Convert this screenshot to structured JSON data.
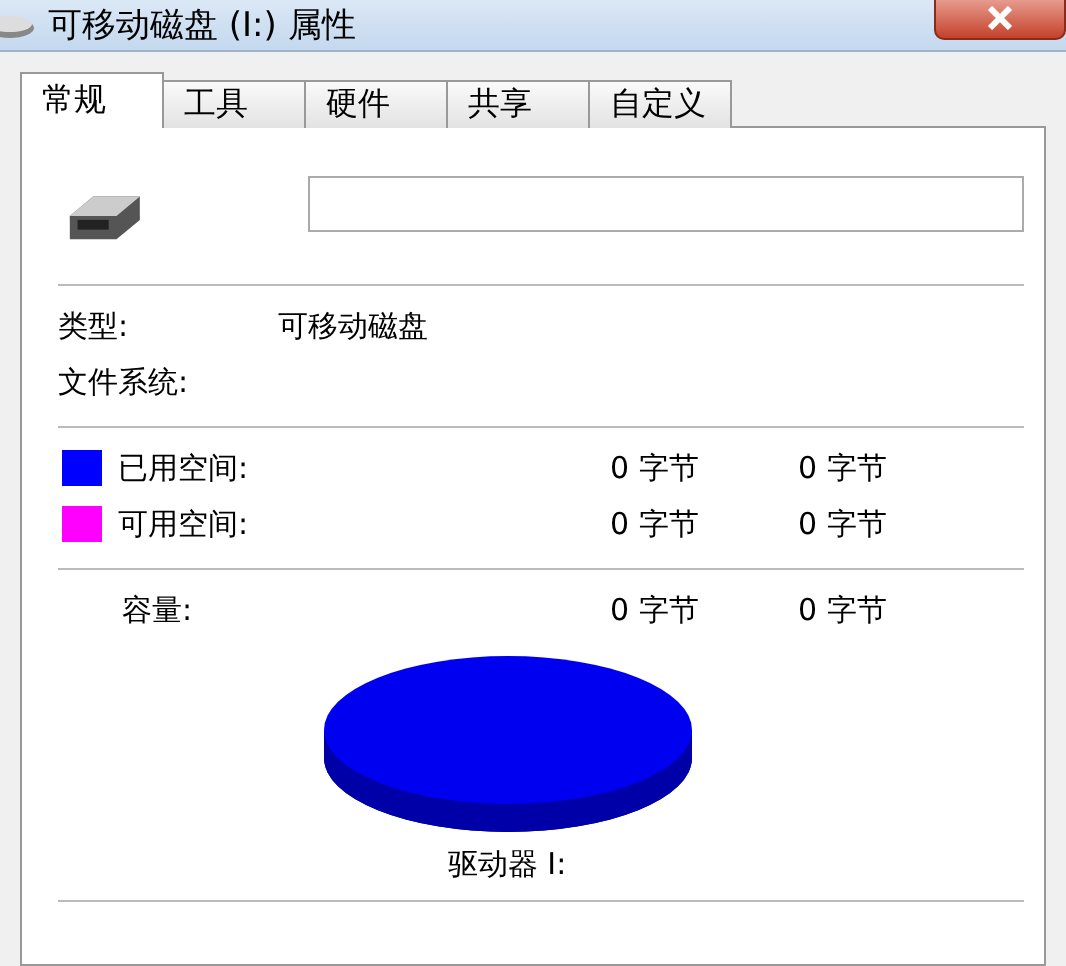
{
  "window": {
    "title": "可移动磁盘 (I:) 属性"
  },
  "tabs": [
    {
      "label": "常规",
      "selected": true
    },
    {
      "label": "工具",
      "selected": false
    },
    {
      "label": "硬件",
      "selected": false
    },
    {
      "label": "共享",
      "selected": false
    },
    {
      "label": "自定义",
      "selected": false
    }
  ],
  "info": [
    {
      "label": "类型:",
      "value": "可移动磁盘"
    },
    {
      "label": "文件系统:"
    }
  ],
  "space": [
    {
      "label": "已用空间:",
      "color": "#0000ff",
      "bytes": "0 字节",
      "size": "0 字节"
    },
    {
      "label": "可用空间:",
      "color": "#ff00ff",
      "bytes": "0 字节",
      "size": "0 字节"
    }
  ],
  "capacity": {
    "label": "容量:",
    "bytes": "0 字节",
    "size": "0 字节"
  },
  "drive_label": "驱动器 I:"
}
